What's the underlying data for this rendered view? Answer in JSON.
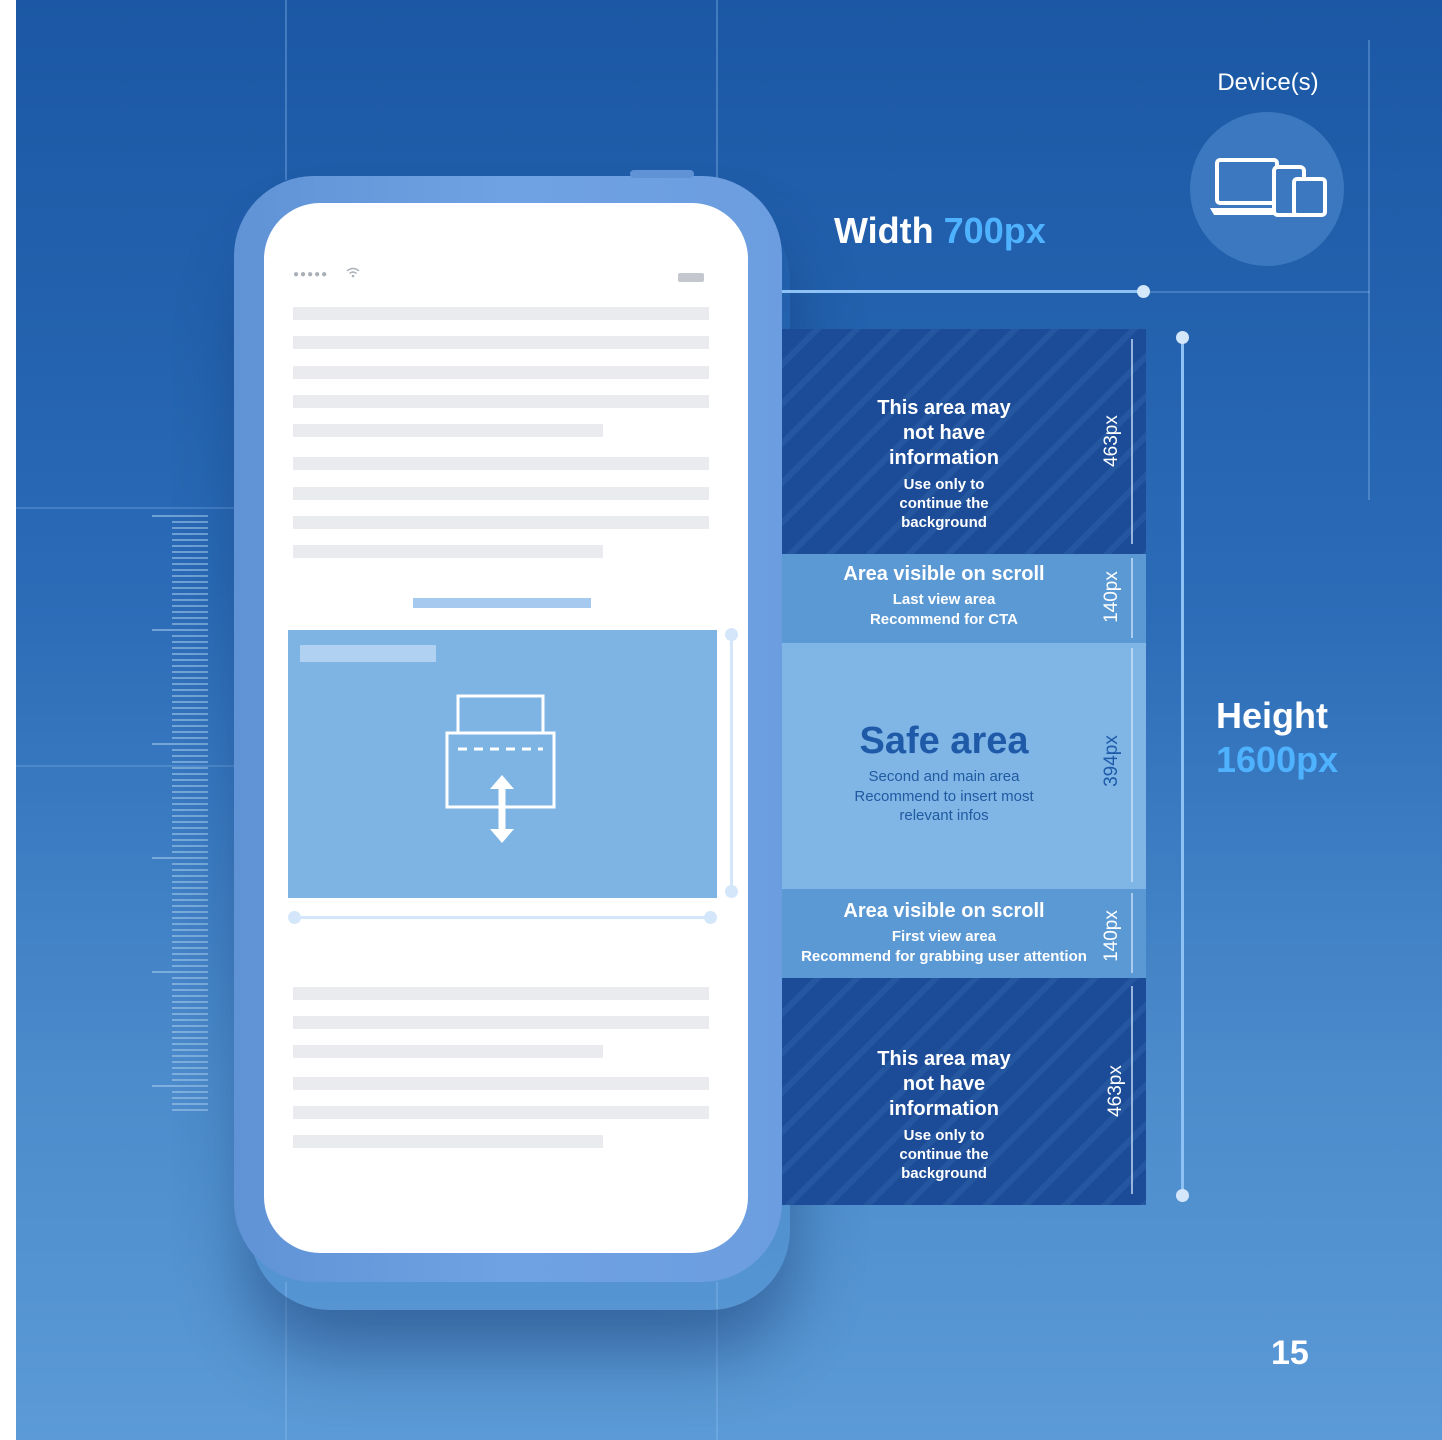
{
  "device": {
    "label": "Device(s)",
    "icon": "devices-icon"
  },
  "width": {
    "label": "Width",
    "value": "700px"
  },
  "height": {
    "label": "Height",
    "value": "1600px"
  },
  "zones": [
    {
      "title": "This area may not have information",
      "subtitle": "Use only to continue the background",
      "size": "463px"
    },
    {
      "title": "Area visible on scroll",
      "subtitle_line1": "Last view area",
      "subtitle_line2": "Recommend for CTA",
      "size": "140px"
    },
    {
      "title": "Safe area",
      "subtitle": "Second and main area Recommend to insert most relevant infos",
      "size": "394px"
    },
    {
      "title": "Area visible on scroll",
      "subtitle_line1": "First view area",
      "subtitle_line2": "Recommend for grabbing user attention",
      "size": "140px"
    },
    {
      "title": "This area may not have information",
      "subtitle": "Use only to continue the background",
      "size": "463px"
    }
  ],
  "phone": {
    "status_dots": "●●●●●",
    "icons": [
      "wifi-icon",
      "battery-icon",
      "scroll-resize-icon"
    ]
  },
  "page_number": "15",
  "colors": {
    "accent": "#4fb2ff",
    "safe_title": "#1f5aa8"
  }
}
